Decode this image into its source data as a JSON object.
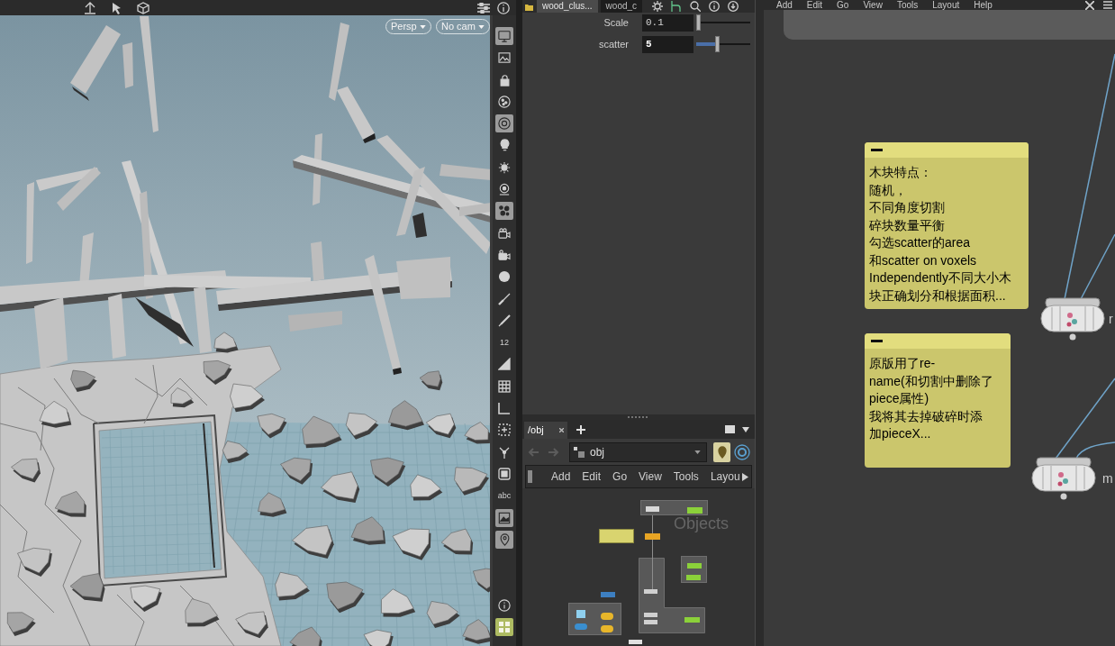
{
  "viewport": {
    "view_menu": "Persp",
    "camera_menu": "No cam",
    "tool_strip": [
      {
        "kind": "icon",
        "on": true
      },
      {
        "kind": "icon",
        "on": false
      },
      {
        "kind": "icon",
        "on": false
      },
      {
        "kind": "icon",
        "on": false
      },
      {
        "kind": "icon",
        "on": true
      },
      {
        "kind": "icon",
        "on": false
      },
      {
        "kind": "icon",
        "on": false
      },
      {
        "kind": "icon",
        "on": false
      },
      {
        "kind": "icon",
        "on": true
      },
      {
        "kind": "icon",
        "on": false
      },
      {
        "kind": "icon",
        "on": false
      },
      {
        "kind": "icon",
        "on": false
      },
      {
        "kind": "icon",
        "on": false
      },
      {
        "kind": "icon",
        "on": false
      },
      {
        "kind": "text",
        "label": "12",
        "on": false
      },
      {
        "kind": "icon",
        "on": false
      },
      {
        "kind": "icon",
        "on": false
      },
      {
        "kind": "icon",
        "on": false
      },
      {
        "kind": "icon",
        "on": false
      },
      {
        "kind": "icon",
        "on": false
      },
      {
        "kind": "icon",
        "on": false
      },
      {
        "kind": "text",
        "label": "abc",
        "on": false
      },
      {
        "kind": "icon",
        "on": true
      },
      {
        "kind": "icon",
        "on": true
      }
    ],
    "tool_strip_bottom": [
      {
        "kind": "icon",
        "on": false
      },
      {
        "kind": "icon",
        "on": true,
        "color": "#aebb62"
      }
    ]
  },
  "parameters": {
    "tabs": [
      {
        "label": "wood_clus...",
        "selected": true
      },
      {
        "label": "wood_c",
        "selected": false
      }
    ],
    "rows": [
      {
        "label": "Scale",
        "value": "0.1",
        "non_default": false,
        "level": 0.03
      },
      {
        "label": "scatter",
        "value": "5",
        "non_default": true,
        "level": 0.38
      }
    ]
  },
  "network_small": {
    "tabs": [
      {
        "label": "/obj",
        "selected": true
      }
    ],
    "path": "obj",
    "pinned": true,
    "menu": [
      "Add",
      "Edit",
      "Go",
      "View",
      "Tools",
      "Layou"
    ],
    "context_label": "Objects"
  },
  "network_main": {
    "menu": [
      "Add",
      "Edit",
      "Go",
      "View",
      "Tools",
      "Layout",
      "Help"
    ],
    "sticky_notes": [
      {
        "lines": [
          "木块特点：",
          "随机，",
          "不同角度切割",
          "碎块数量平衡",
          "勾选scatter的area",
          "和scatter on voxels",
          "Independently不同大小木",
          "块正确划分和根据面积..."
        ]
      },
      {
        "lines": [
          "原版用了re-",
          "name(和切割中删除了",
          "piece属性)",
          "我将其去掉破碎时添",
          "加pieceX..."
        ]
      }
    ],
    "nodes": [
      {
        "label": "r"
      },
      {
        "label": "m"
      }
    ]
  }
}
